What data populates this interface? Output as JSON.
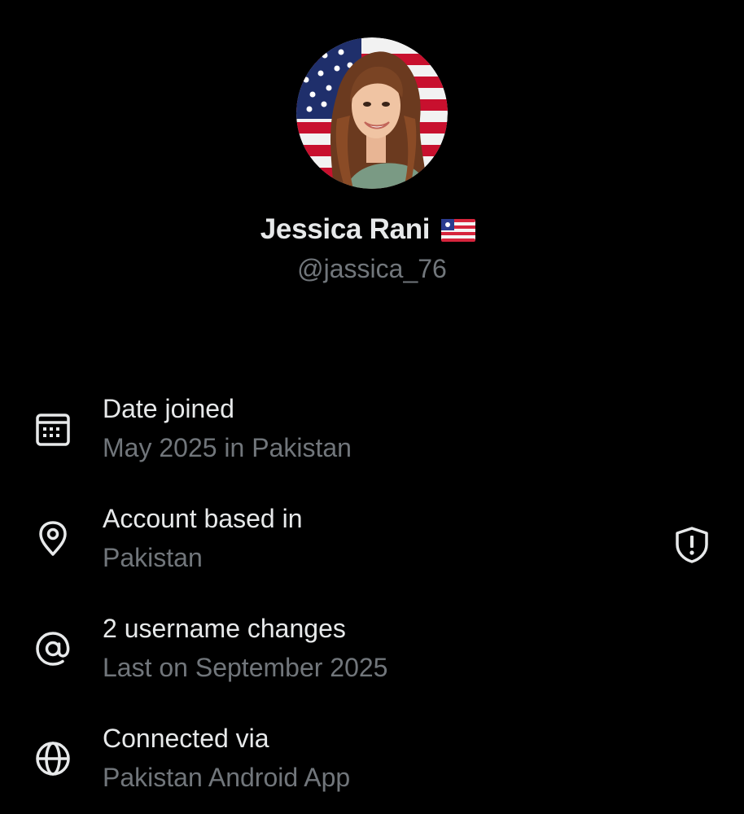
{
  "profile": {
    "avatar_icon": "profile-photo",
    "display_name": "Jessica Rani",
    "name_flag_icon": "flag-emoji",
    "handle": "@jassica_76"
  },
  "about": [
    {
      "icon": "calendar-icon",
      "title": "Date joined",
      "subtitle": "May 2025 in Pakistan"
    },
    {
      "icon": "location-pin-icon",
      "title": "Account based in",
      "subtitle": "Pakistan",
      "side_icon": "shield-alert-icon"
    },
    {
      "icon": "at-sign-icon",
      "title": "2 username changes",
      "subtitle": "Last on September 2025"
    },
    {
      "icon": "globe-icon",
      "title": "Connected via",
      "subtitle": "Pakistan Android App"
    }
  ],
  "colors": {
    "background": "#000000",
    "primary_text": "#e7e9ea",
    "secondary_text": "#71767b"
  }
}
